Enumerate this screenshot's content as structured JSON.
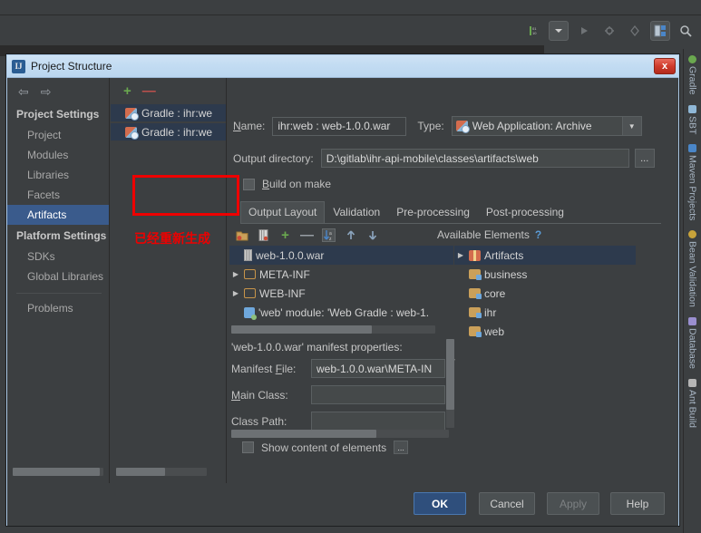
{
  "ide": {
    "toolbar_icons": [
      "debug-variables-icon",
      "run-config-dropdown-icon",
      "run-icon",
      "debug-icon",
      "coverage-icon",
      "project-structure-icon",
      "search-icon"
    ],
    "right_rail": [
      {
        "label": "Gradle",
        "icon": "gradle-icon",
        "color": "#6aa84f"
      },
      {
        "label": "SBT",
        "icon": "sbt-icon",
        "color": "#8fb7d6"
      },
      {
        "label": "Maven Projects",
        "icon": "maven-icon",
        "color": "#4a86c8"
      },
      {
        "label": "Bean Validation",
        "icon": "bean-validation-icon",
        "color": "#c8a33a"
      },
      {
        "label": "Database",
        "icon": "database-icon",
        "color": "#9a8fd0"
      },
      {
        "label": "Ant Build",
        "icon": "ant-build-icon",
        "color": "#b5b5b5"
      }
    ]
  },
  "dialog": {
    "title": "Project Structure",
    "title_icon": "intellij-logo-icon",
    "close_label": "x"
  },
  "nav": {
    "back_icon": "arrow-left-icon",
    "forward_icon": "arrow-right-icon",
    "groups": [
      {
        "title": "Project Settings",
        "items": [
          {
            "label": "Project",
            "selected": false
          },
          {
            "label": "Modules",
            "selected": false
          },
          {
            "label": "Libraries",
            "selected": false
          },
          {
            "label": "Facets",
            "selected": false
          },
          {
            "label": "Artifacts",
            "selected": true
          }
        ]
      },
      {
        "title": "Platform Settings",
        "items": [
          {
            "label": "SDKs",
            "selected": false
          },
          {
            "label": "Global Libraries",
            "selected": false
          }
        ]
      }
    ],
    "problems_label": "Problems"
  },
  "artifact_list": {
    "add_label": "+",
    "remove_label": "—",
    "items": [
      {
        "label": "Gradle : ihr:we",
        "icon": "artifact-icon",
        "selected": true
      },
      {
        "label": "Gradle : ihr:we",
        "icon": "artifact-icon",
        "selected": true
      }
    ],
    "annotation_text": "已经重新生成",
    "annotation_color": "#ee0000"
  },
  "details": {
    "name_label": "Name:",
    "name_value": "ihr:web : web-1.0.0.war",
    "type_label": "Type:",
    "type_value": "Web Application: Archive",
    "type_icon": "web-archive-icon",
    "type_dropdown_icon": "chevron-down-icon",
    "output_dir_label": "Output directory:",
    "output_dir_value": "D:\\gitlab\\ihr-api-mobile\\classes\\artifacts\\web",
    "output_dir_browse_label": "...",
    "build_on_make_label": "Build on make",
    "build_on_make_checked": false,
    "tabs": [
      {
        "label": "Output Layout",
        "active": true
      },
      {
        "label": "Validation",
        "active": false
      },
      {
        "label": "Pre-processing",
        "active": false
      },
      {
        "label": "Post-processing",
        "active": false
      }
    ],
    "tree_toolbar": [
      {
        "icon": "add-directory-icon"
      },
      {
        "icon": "add-archive-icon"
      },
      {
        "icon": "add-copy-icon"
      },
      {
        "icon": "remove-icon"
      },
      {
        "icon": "sort-az-icon"
      },
      {
        "icon": "move-up-icon"
      },
      {
        "icon": "move-down-icon"
      }
    ],
    "output_tree": [
      {
        "label": "web-1.0.0.war",
        "icon": "jar-icon",
        "indent": 0,
        "expander": "none",
        "selected": true
      },
      {
        "label": "META-INF",
        "icon": "folder-icon",
        "indent": 1,
        "expander": "collapsed",
        "selected": false
      },
      {
        "label": "WEB-INF",
        "icon": "folder-icon",
        "indent": 1,
        "expander": "collapsed",
        "selected": false
      },
      {
        "label": "'web' module: 'Web Gradle : web-1.",
        "icon": "module-icon",
        "indent": 1,
        "expander": "none",
        "selected": false
      }
    ],
    "available_elements_label": "Available Elements",
    "available_help_label": "?",
    "available_tree": [
      {
        "label": "Artifacts",
        "icon": "artifacts-icon",
        "expander": "collapsed",
        "selected": true
      },
      {
        "label": "business",
        "icon": "folder-module-icon",
        "expander": "none",
        "selected": false
      },
      {
        "label": "core",
        "icon": "folder-module-icon",
        "expander": "none",
        "selected": false
      },
      {
        "label": "ihr",
        "icon": "folder-module-icon",
        "expander": "collapsed",
        "selected": false
      },
      {
        "label": "web",
        "icon": "folder-module-icon",
        "expander": "none",
        "selected": false
      }
    ],
    "manifest_title": "'web-1.0.0.war' manifest properties:",
    "manifest_file_label": "Manifest File:",
    "manifest_file_value": "web-1.0.0.war\\META-IN",
    "main_class_label": "Main Class:",
    "main_class_value": "",
    "class_path_label": "Class Path:",
    "class_path_value": "",
    "show_content_label": "Show content of elements",
    "show_content_checked": false,
    "show_content_more_label": "..."
  },
  "buttons": {
    "ok": "OK",
    "cancel": "Cancel",
    "apply": "Apply",
    "help": "Help"
  }
}
